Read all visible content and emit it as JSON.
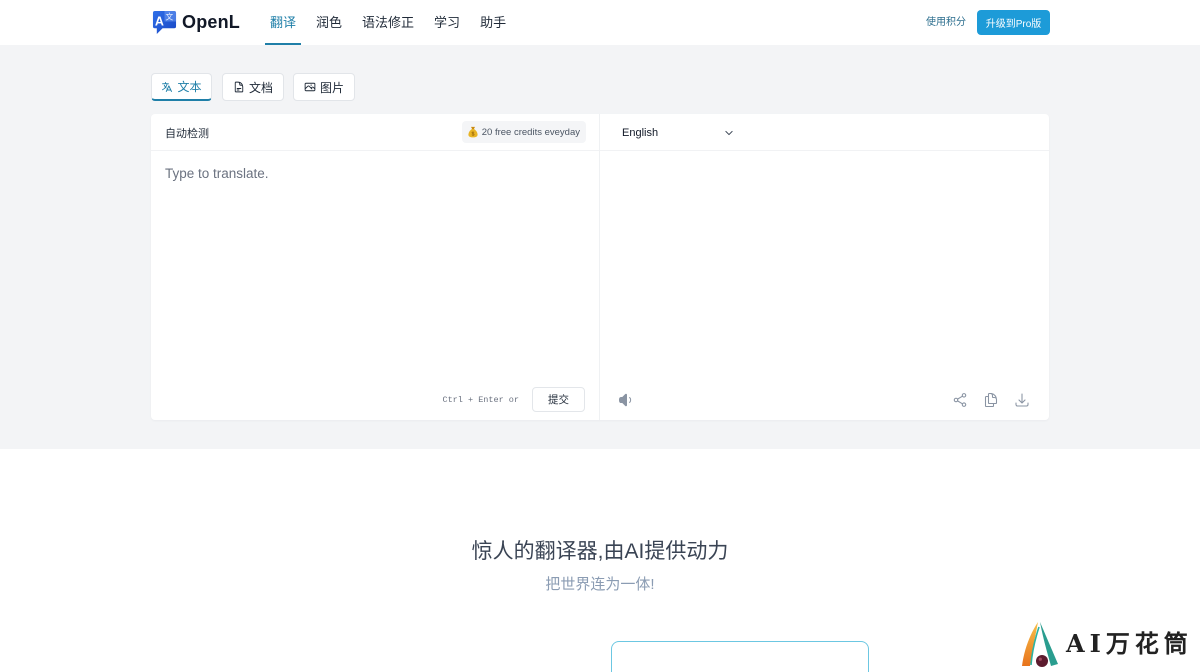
{
  "colors": {
    "accent": "#1f7fa8",
    "upgrade": "#1d9bd8",
    "page-gray": "#f3f4f6",
    "icon-gray": "#8a94a3",
    "hero-title": "#3a4454",
    "hero-subtitle": "#8b9cb3",
    "feature-border": "#6cc7e2"
  },
  "header": {
    "logo": {
      "icon": "openl-logo-icon",
      "icon_letters": {
        "latin": "A",
        "cjk": "文"
      },
      "text": "OpenL"
    },
    "nav": [
      {
        "label": "翻译",
        "active": true
      },
      {
        "label": "润色",
        "active": false
      },
      {
        "label": "语法修正",
        "active": false
      },
      {
        "label": "学习",
        "active": false
      },
      {
        "label": "助手",
        "active": false
      }
    ],
    "credits_link": "使用积分",
    "upgrade_button": "升级到Pro版"
  },
  "mode_tabs": [
    {
      "label": "文本",
      "icon": "translate-icon",
      "active": true
    },
    {
      "label": "文档",
      "icon": "document-icon",
      "active": false
    },
    {
      "label": "图片",
      "icon": "image-icon",
      "active": false
    }
  ],
  "translator": {
    "source": {
      "language": "自动检测",
      "credits_badge": {
        "icon": "money-bag-icon",
        "text": "20 free credits eveyday"
      },
      "placeholder": "Type to translate.",
      "shortcut_hint": "Ctrl + Enter or",
      "submit_label": "提交"
    },
    "target": {
      "language": "English",
      "dropdown_icon": "chevron-down-icon",
      "actions": [
        {
          "icon": "speaker-icon"
        },
        {
          "icon": "share-icon"
        },
        {
          "icon": "copy-icon"
        },
        {
          "icon": "download-icon"
        }
      ]
    }
  },
  "hero": {
    "title": "惊人的翻译器,由AI提供动力",
    "subtitle": "把世界连为一体!"
  },
  "watermark": {
    "icon": "ai-kaleidoscope-logo-icon",
    "text": "AI万花筒"
  }
}
